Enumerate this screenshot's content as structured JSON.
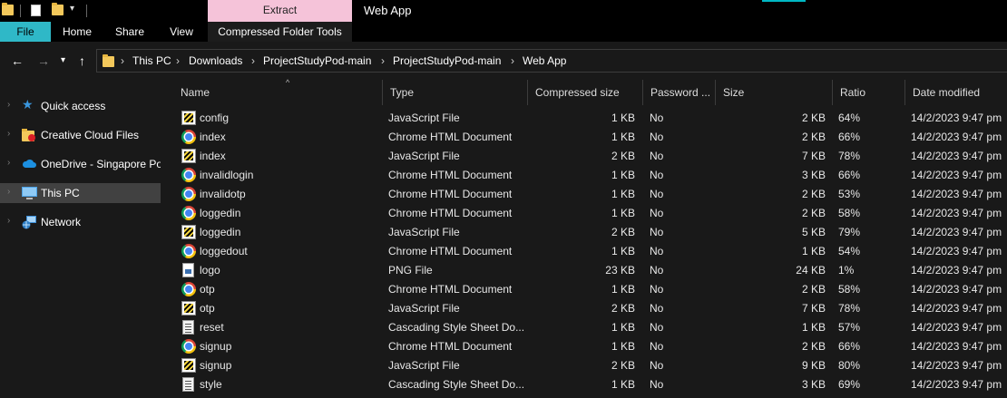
{
  "titlebar": {
    "contextual_tab": "Extract",
    "window_title": "Web App"
  },
  "ribbon": {
    "tabs": [
      {
        "label": "File"
      },
      {
        "label": "Home"
      },
      {
        "label": "Share"
      },
      {
        "label": "View"
      },
      {
        "label": "Compressed Folder Tools"
      }
    ]
  },
  "address": {
    "crumbs": [
      "This PC",
      "Downloads",
      "ProjectStudyPod-main",
      "ProjectStudyPod-main",
      "Web App"
    ],
    "separator": "›"
  },
  "sidebar": {
    "items": [
      {
        "label": "Quick access",
        "icon": "star-icon"
      },
      {
        "label": "Creative Cloud Files",
        "icon": "creative-cloud-folder-icon"
      },
      {
        "label": "OneDrive - Singapore Pol",
        "icon": "cloud-icon"
      },
      {
        "label": "This PC",
        "icon": "computer-icon"
      },
      {
        "label": "Network",
        "icon": "network-icon"
      }
    ]
  },
  "columns": {
    "name": "Name",
    "type": "Type",
    "compressed": "Compressed size",
    "password": "Password ...",
    "size": "Size",
    "ratio": "Ratio",
    "date": "Date modified"
  },
  "files": [
    {
      "name": "config",
      "type": "JavaScript File",
      "icon": "js",
      "compressed": "1 KB",
      "password": "No",
      "size": "2 KB",
      "ratio": "64%",
      "date": "14/2/2023 9:47 pm"
    },
    {
      "name": "index",
      "type": "Chrome HTML Document",
      "icon": "chrome",
      "compressed": "1 KB",
      "password": "No",
      "size": "2 KB",
      "ratio": "66%",
      "date": "14/2/2023 9:47 pm"
    },
    {
      "name": "index",
      "type": "JavaScript File",
      "icon": "js",
      "compressed": "2 KB",
      "password": "No",
      "size": "7 KB",
      "ratio": "78%",
      "date": "14/2/2023 9:47 pm"
    },
    {
      "name": "invalidlogin",
      "type": "Chrome HTML Document",
      "icon": "chrome",
      "compressed": "1 KB",
      "password": "No",
      "size": "3 KB",
      "ratio": "66%",
      "date": "14/2/2023 9:47 pm"
    },
    {
      "name": "invalidotp",
      "type": "Chrome HTML Document",
      "icon": "chrome",
      "compressed": "1 KB",
      "password": "No",
      "size": "2 KB",
      "ratio": "53%",
      "date": "14/2/2023 9:47 pm"
    },
    {
      "name": "loggedin",
      "type": "Chrome HTML Document",
      "icon": "chrome",
      "compressed": "1 KB",
      "password": "No",
      "size": "2 KB",
      "ratio": "58%",
      "date": "14/2/2023 9:47 pm"
    },
    {
      "name": "loggedin",
      "type": "JavaScript File",
      "icon": "js",
      "compressed": "2 KB",
      "password": "No",
      "size": "5 KB",
      "ratio": "79%",
      "date": "14/2/2023 9:47 pm"
    },
    {
      "name": "loggedout",
      "type": "Chrome HTML Document",
      "icon": "chrome",
      "compressed": "1 KB",
      "password": "No",
      "size": "1 KB",
      "ratio": "54%",
      "date": "14/2/2023 9:47 pm"
    },
    {
      "name": "logo",
      "type": "PNG File",
      "icon": "png",
      "compressed": "23 KB",
      "password": "No",
      "size": "24 KB",
      "ratio": "1%",
      "date": "14/2/2023 9:47 pm"
    },
    {
      "name": "otp",
      "type": "Chrome HTML Document",
      "icon": "chrome",
      "compressed": "1 KB",
      "password": "No",
      "size": "2 KB",
      "ratio": "58%",
      "date": "14/2/2023 9:47 pm"
    },
    {
      "name": "otp",
      "type": "JavaScript File",
      "icon": "js",
      "compressed": "2 KB",
      "password": "No",
      "size": "7 KB",
      "ratio": "78%",
      "date": "14/2/2023 9:47 pm"
    },
    {
      "name": "reset",
      "type": "Cascading Style Sheet Do...",
      "icon": "css",
      "compressed": "1 KB",
      "password": "No",
      "size": "1 KB",
      "ratio": "57%",
      "date": "14/2/2023 9:47 pm"
    },
    {
      "name": "signup",
      "type": "Chrome HTML Document",
      "icon": "chrome",
      "compressed": "1 KB",
      "password": "No",
      "size": "2 KB",
      "ratio": "66%",
      "date": "14/2/2023 9:47 pm"
    },
    {
      "name": "signup",
      "type": "JavaScript File",
      "icon": "js",
      "compressed": "2 KB",
      "password": "No",
      "size": "9 KB",
      "ratio": "80%",
      "date": "14/2/2023 9:47 pm"
    },
    {
      "name": "style",
      "type": "Cascading Style Sheet Do...",
      "icon": "css",
      "compressed": "1 KB",
      "password": "No",
      "size": "3 KB",
      "ratio": "69%",
      "date": "14/2/2023 9:47 pm"
    }
  ],
  "colors": {
    "file_tab": "#2fb8c7",
    "extract_tab": "#f5c3d9",
    "background": "#191919",
    "selected": "#414141"
  }
}
